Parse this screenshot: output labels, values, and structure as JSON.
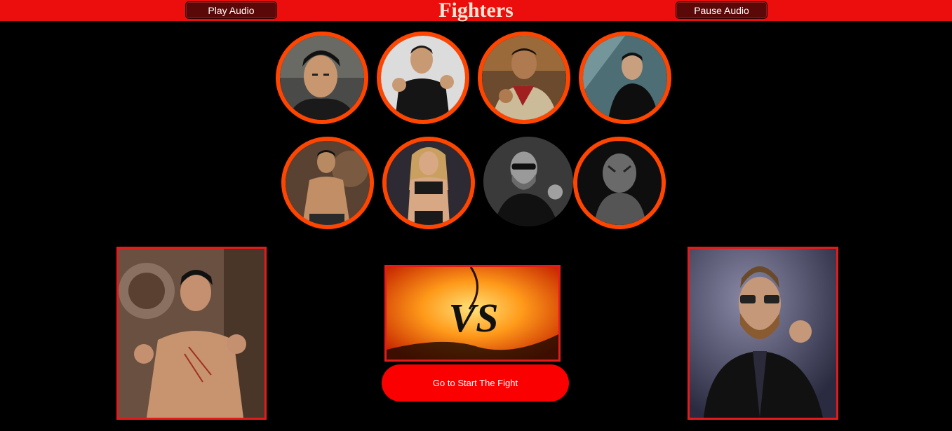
{
  "header": {
    "title": "Fighters",
    "play_audio_label": "Play Audio",
    "pause_audio_label": "Pause Audio"
  },
  "fighters": [
    {
      "icon": "fighter-portrait-1",
      "bg": "#3a3a3a"
    },
    {
      "icon": "fighter-portrait-2",
      "bg": "#d9d9d9"
    },
    {
      "icon": "fighter-portrait-3",
      "bg": "#8a6a4a"
    },
    {
      "icon": "fighter-portrait-4",
      "bg": "#5a7a80"
    },
    {
      "icon": "fighter-portrait-5",
      "bg": "#6b4a38"
    },
    {
      "icon": "fighter-portrait-6",
      "bg": "#3a3040"
    },
    {
      "icon": "fighter-portrait-7",
      "bg": "#404040"
    },
    {
      "icon": "fighter-portrait-8",
      "bg": "#1a1a1a"
    }
  ],
  "player_one": {
    "icon": "selected-fighter-left-portrait"
  },
  "player_two": {
    "icon": "selected-fighter-right-portrait"
  },
  "versus": {
    "text": "VS"
  },
  "fight_button_label": "Go to Start The Fight",
  "colors": {
    "header_bg": "#ec0d0d",
    "accent_border": "#ff4500",
    "frame_border": "#e41b1b",
    "fight_button": "#fa0000"
  }
}
